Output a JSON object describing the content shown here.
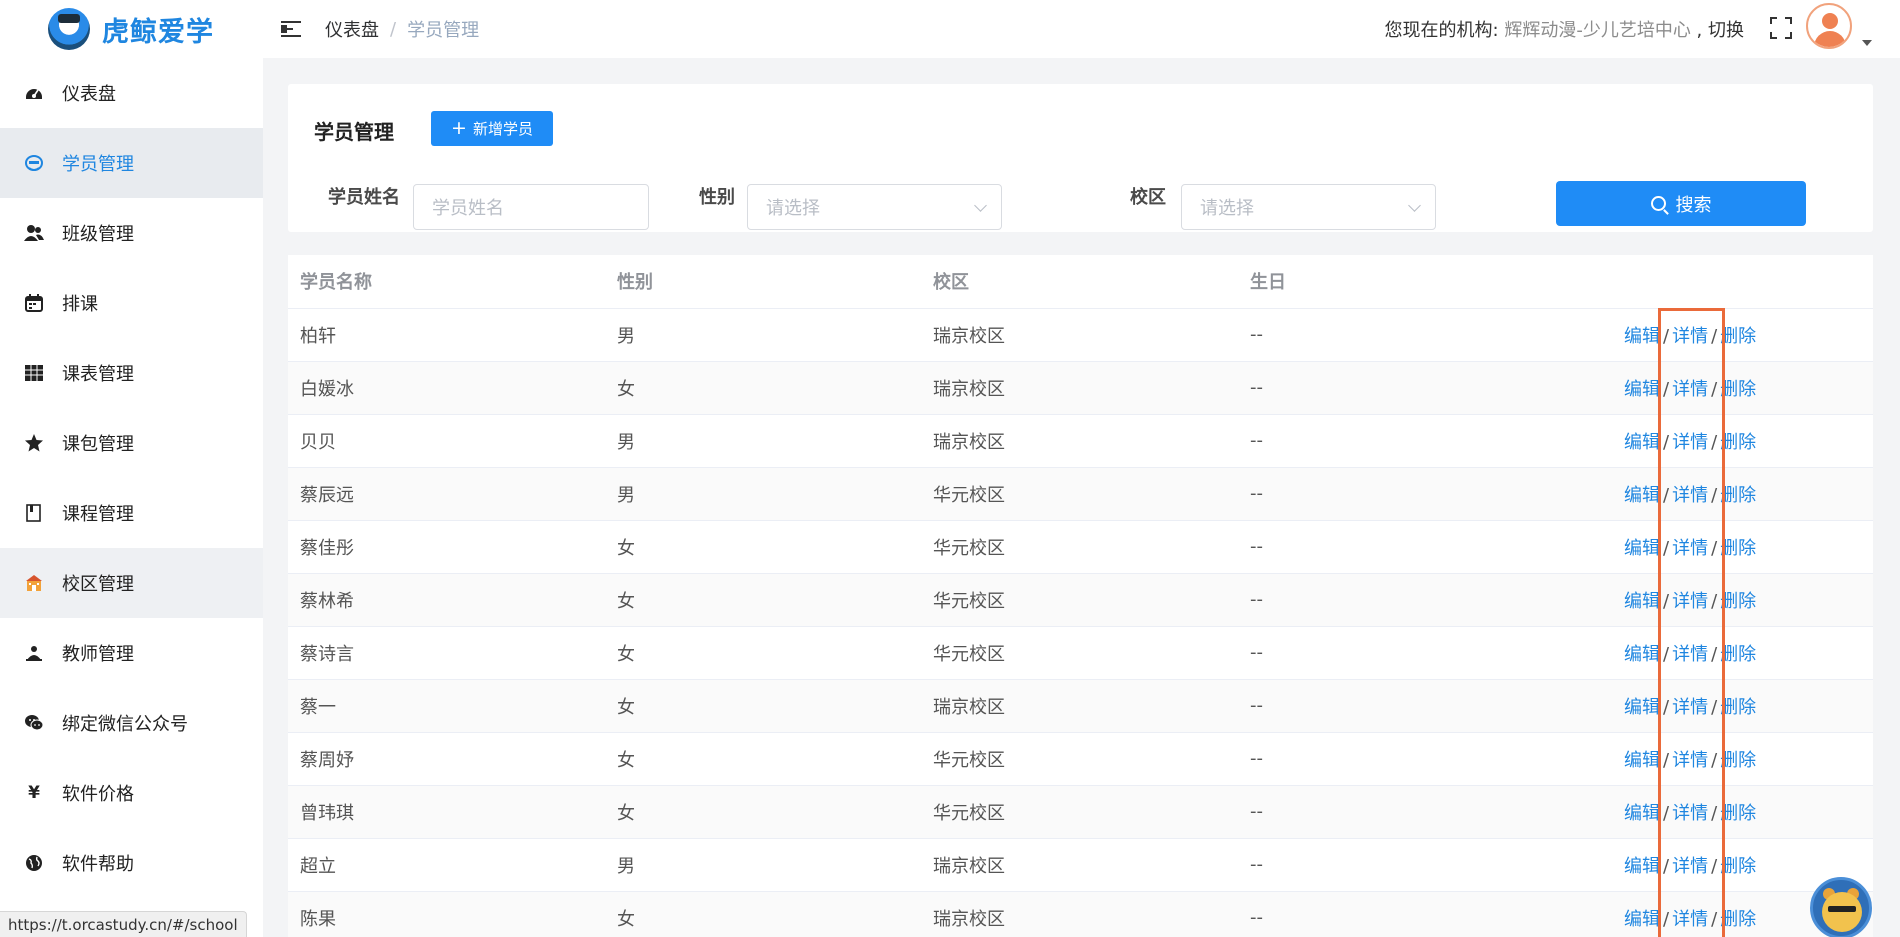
{
  "app": {
    "brand": "虎鲸爱学"
  },
  "breadcrumb": {
    "items": [
      "仪表盘",
      "学员管理"
    ],
    "separator": "/"
  },
  "org": {
    "prefix": "您现在的机构: ",
    "name": "辉辉动漫-少儿艺培中心",
    "switch": " , 切换"
  },
  "sidebar": {
    "items": [
      {
        "label": "仪表盘",
        "icon": "dashboard-icon"
      },
      {
        "label": "学员管理",
        "icon": "student-icon"
      },
      {
        "label": "班级管理",
        "icon": "users-icon"
      },
      {
        "label": "排课",
        "icon": "calendar-icon"
      },
      {
        "label": "课表管理",
        "icon": "table-icon"
      },
      {
        "label": "课包管理",
        "icon": "star-icon"
      },
      {
        "label": "课程管理",
        "icon": "book-icon"
      },
      {
        "label": "校区管理",
        "icon": "school-icon"
      },
      {
        "label": "教师管理",
        "icon": "teacher-icon"
      },
      {
        "label": "绑定微信公众号",
        "icon": "wechat-icon"
      },
      {
        "label": "软件价格",
        "icon": "yen-icon"
      },
      {
        "label": "软件帮助",
        "icon": "globe-icon"
      }
    ],
    "active_index": 1
  },
  "search_card": {
    "title": "学员管理",
    "add_button": "新增学员",
    "name_label": "学员姓名",
    "name_placeholder": "学员姓名",
    "gender_label": "性别",
    "gender_placeholder": "请选择",
    "campus_label": "校区",
    "campus_placeholder": "请选择",
    "search_button": "搜索"
  },
  "table": {
    "headers": [
      "学员名称",
      "性别",
      "校区",
      "生日",
      ""
    ],
    "op_edit": "编辑",
    "op_detail": "详情",
    "op_delete": "删除",
    "op_sep": "/",
    "rows": [
      {
        "name": "柏轩",
        "gender": "男",
        "campus": "瑞京校区",
        "birthday": "--"
      },
      {
        "name": "白媛冰",
        "gender": "女",
        "campus": "瑞京校区",
        "birthday": "--"
      },
      {
        "name": "贝贝",
        "gender": "男",
        "campus": "瑞京校区",
        "birthday": "--"
      },
      {
        "name": "蔡辰远",
        "gender": "男",
        "campus": "华元校区",
        "birthday": "--"
      },
      {
        "name": "蔡佳彤",
        "gender": "女",
        "campus": "华元校区",
        "birthday": "--"
      },
      {
        "name": "蔡林希",
        "gender": "女",
        "campus": "华元校区",
        "birthday": "--"
      },
      {
        "name": "蔡诗言",
        "gender": "女",
        "campus": "华元校区",
        "birthday": "--"
      },
      {
        "name": "蔡一",
        "gender": "女",
        "campus": "瑞京校区",
        "birthday": "--"
      },
      {
        "name": "蔡周妤",
        "gender": "女",
        "campus": "华元校区",
        "birthday": "--"
      },
      {
        "name": "曾玮琪",
        "gender": "女",
        "campus": "华元校区",
        "birthday": "--"
      },
      {
        "name": "超立",
        "gender": "男",
        "campus": "瑞京校区",
        "birthday": "--"
      },
      {
        "name": "陈果",
        "gender": "女",
        "campus": "瑞京校区",
        "birthday": "--"
      }
    ]
  },
  "status_bar": {
    "url": "https://t.orcastudy.cn/#/school"
  },
  "colors": {
    "primary": "#1f8cf6",
    "link": "#1f86e0",
    "highlight": "#ea6a3a"
  }
}
